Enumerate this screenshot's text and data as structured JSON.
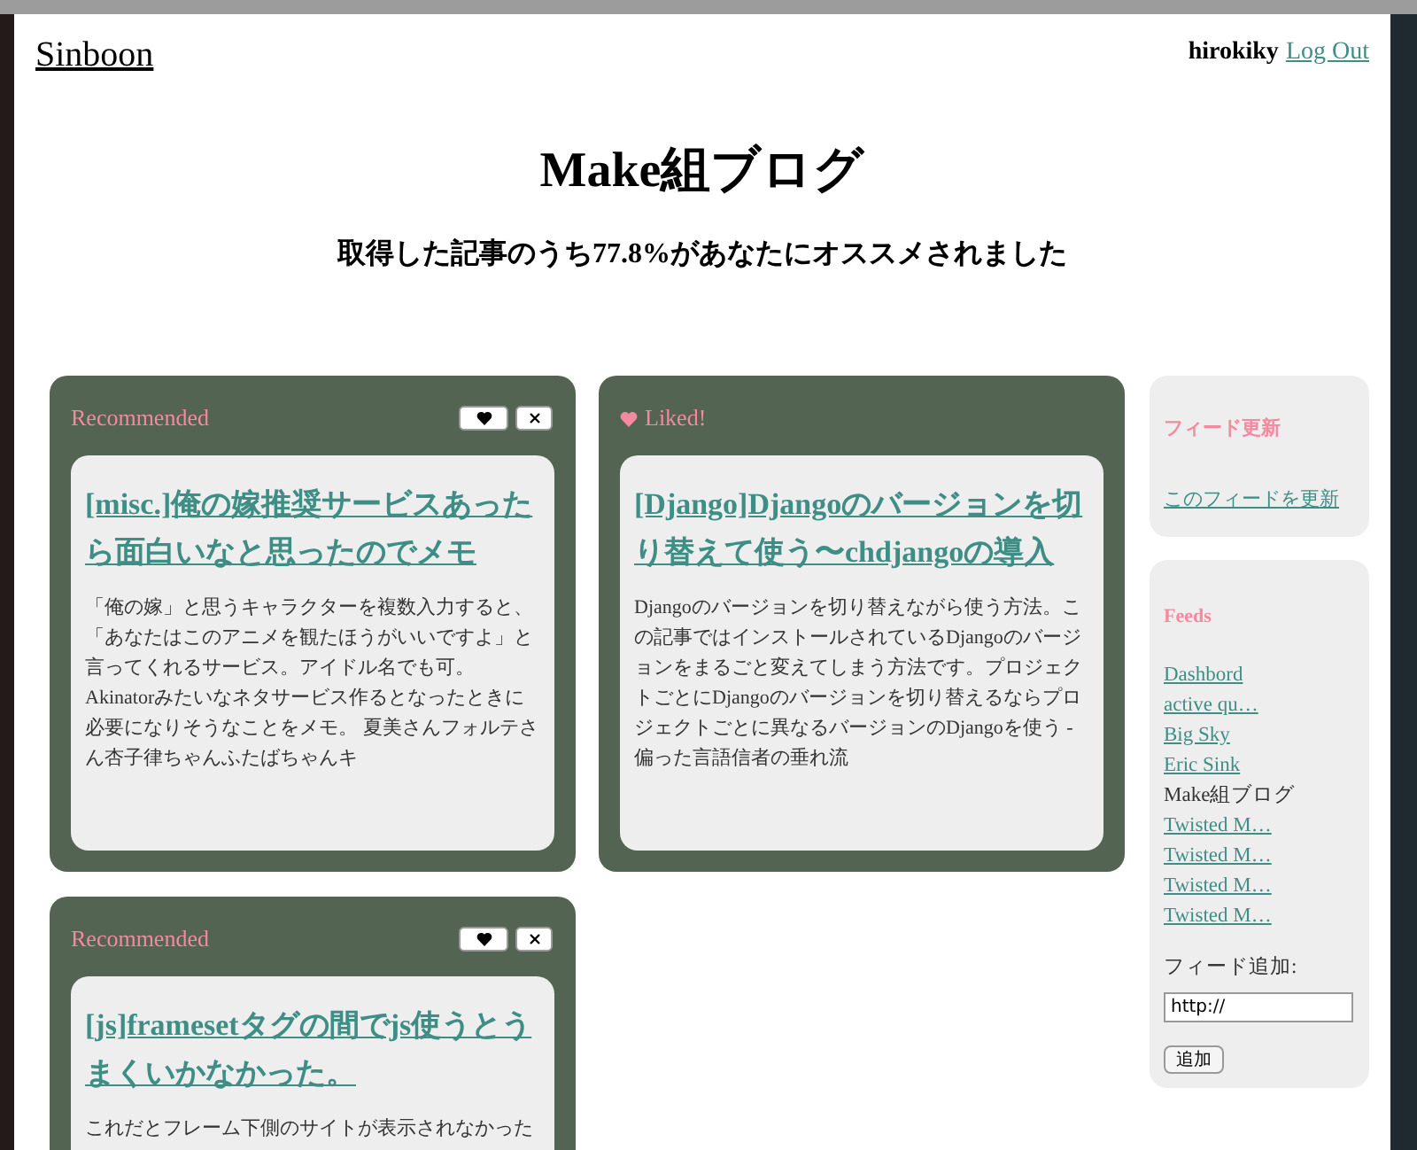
{
  "header": {
    "site_title": "Sinboon",
    "username": "hirokiky",
    "logout": "Log Out"
  },
  "blog_title": "Make組ブログ",
  "summary": "取得した記事のうち77.8%があなたにオススメされました",
  "entries": [
    {
      "label": "Recommended",
      "liked": false,
      "title": "[misc.]俺の嫁推奨サービスあったら面白いなと思ったのでメモ",
      "body": "「俺の嫁」と思うキャラクターを複数入力すると、「あなたはこのアニメを観たほうがいいですよ」と言ってくれるサービス。アイドル名でも可。Akinatorみたいなネタサービス作るとなったときに必要になりそうなことをメモ。 夏美さんフォルテさん杏子律ちゃんふたばちゃんキ"
    },
    {
      "label": "Liked!",
      "liked": true,
      "title": "[Django]Djangoのバージョンを切り替えて使う〜chdjangoの導入",
      "body": "Djangoのバージョンを切り替えながら使う方法。この記事ではインストールされているDjangoのバージョンをまるごと変えてしまう方法です。プロジェクトごとにDjangoのバージョンを切り替えるならプロジェクトごとに異なるバージョンのDjangoを使う - 偏った言語信者の垂れ流"
    },
    {
      "label": "Recommended",
      "liked": false,
      "title": "[js]framesetタグの間でjs使うとうまくいかなかった。",
      "body": "これだとフレーム下側のサイトが表示されなかった"
    }
  ],
  "sidebar": {
    "update": {
      "heading": "フィード更新",
      "link": "このフィードを更新"
    },
    "feeds": {
      "heading": "Feeds",
      "items": [
        {
          "label": "Dashbord",
          "selected": false
        },
        {
          "label": "active qu…",
          "selected": false
        },
        {
          "label": "Big Sky",
          "selected": false
        },
        {
          "label": "Eric Sink",
          "selected": false
        },
        {
          "label": "Make組ブログ",
          "selected": true
        },
        {
          "label": "Twisted M…",
          "selected": false
        },
        {
          "label": "Twisted M…",
          "selected": false
        },
        {
          "label": "Twisted M…",
          "selected": false
        },
        {
          "label": "Twisted M…",
          "selected": false
        }
      ],
      "add_label": "フィード追加:",
      "add_value": "http://",
      "add_button": "追加"
    }
  }
}
